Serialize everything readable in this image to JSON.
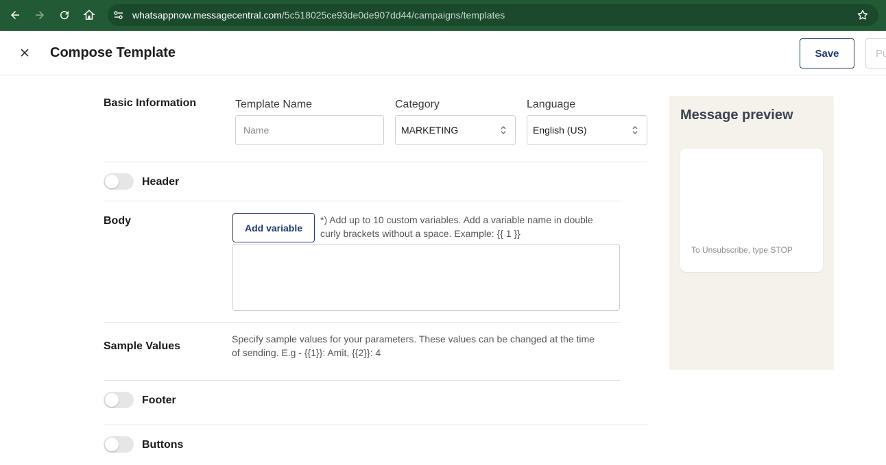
{
  "browser": {
    "url_host": "whatsappnow.messagecentral.com",
    "url_path": "/5c518025ce93de0de907dd44/campaigns/templates"
  },
  "header": {
    "title": "Compose Template",
    "save_label": "Save",
    "publish_label": "Pu"
  },
  "basic_info": {
    "section_label": "Basic Information",
    "template_name_label": "Template Name",
    "template_name_placeholder": "Name",
    "template_name_value": "",
    "category_label": "Category",
    "category_value": "MARKETING",
    "language_label": "Language",
    "language_value": "English (US)"
  },
  "header_section": {
    "label": "Header",
    "enabled": false
  },
  "body": {
    "label": "Body",
    "add_variable_label": "Add variable",
    "helper_line1": "*) Add up to 10 custom variables. Add a variable name in double",
    "helper_line2": "curly brackets without a space. Example: {{ 1 }}"
  },
  "sample_values": {
    "label": "Sample Values",
    "helper_line1": "Specify sample values for your parameters. These values can be changed at the time",
    "helper_line2": "of sending. E.g - {{1}}: Amit, {{2}}: 4"
  },
  "footer_section": {
    "label": "Footer",
    "enabled": false
  },
  "buttons_section": {
    "label": "Buttons",
    "enabled": false
  },
  "preview": {
    "title": "Message preview",
    "footer_text": "To Unsubscribe, type STOP"
  },
  "colors": {
    "browser_bar": "#235a36",
    "accent": "#1f3a6e",
    "preview_bg": "#f5f2ec"
  }
}
